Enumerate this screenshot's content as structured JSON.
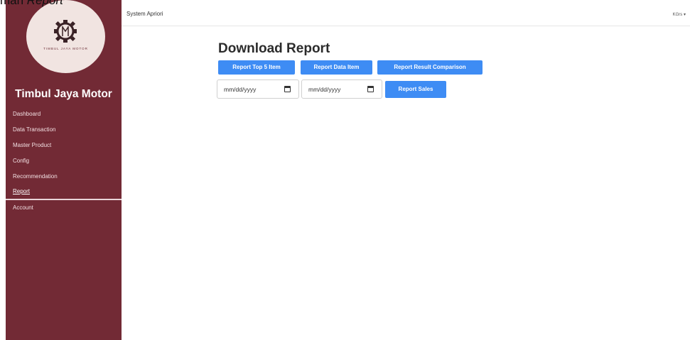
{
  "caption": {
    "prefix": "man ",
    "italic": "Report"
  },
  "sidebar": {
    "logo_text": "TIMBUL JAYA MOTOR",
    "brand": "Timbul Jaya Motor",
    "items": [
      {
        "label": "Dashboard"
      },
      {
        "label": "Data Transaction"
      },
      {
        "label": "Master Product"
      },
      {
        "label": "Config"
      },
      {
        "label": "Recommendation"
      },
      {
        "label": "Report",
        "active": true
      },
      {
        "label": "Account"
      }
    ]
  },
  "topbar": {
    "title": "System Apriori",
    "user": "KGrs ▾"
  },
  "main": {
    "title": "Download Report",
    "buttons": {
      "top5": "Report Top 5 Item",
      "data_item": "Report Data Item",
      "comparison": "Report Result Comparison",
      "sales": "Report Sales"
    },
    "date_start": {
      "placeholder": "mm/dd/yyyy"
    },
    "date_end": {
      "placeholder": "mm/dd/yyyy"
    }
  },
  "colors": {
    "sidebar": "#722a35",
    "accent": "#3e8cf4",
    "logo_bg": "#f1e4e1"
  },
  "icons": {
    "calendar": "calendar-icon",
    "logo": "gear-logo-icon"
  }
}
